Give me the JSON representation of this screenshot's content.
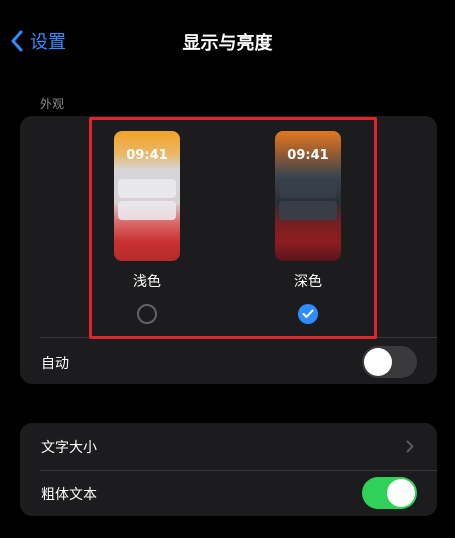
{
  "nav": {
    "back_label": "设置",
    "title": "显示与亮度"
  },
  "appearance": {
    "header": "外观",
    "options": [
      {
        "time": "09:41",
        "label": "浅色",
        "selected": false
      },
      {
        "time": "09:41",
        "label": "深色",
        "selected": true
      }
    ],
    "auto": {
      "label": "自动",
      "on": false
    }
  },
  "text_settings": {
    "text_size": {
      "label": "文字大小"
    },
    "bold_text": {
      "label": "粗体文本",
      "on": true
    }
  },
  "colors": {
    "accent": "#2f8cff",
    "toggle_on": "#30d158",
    "highlight": "#e0252e"
  }
}
